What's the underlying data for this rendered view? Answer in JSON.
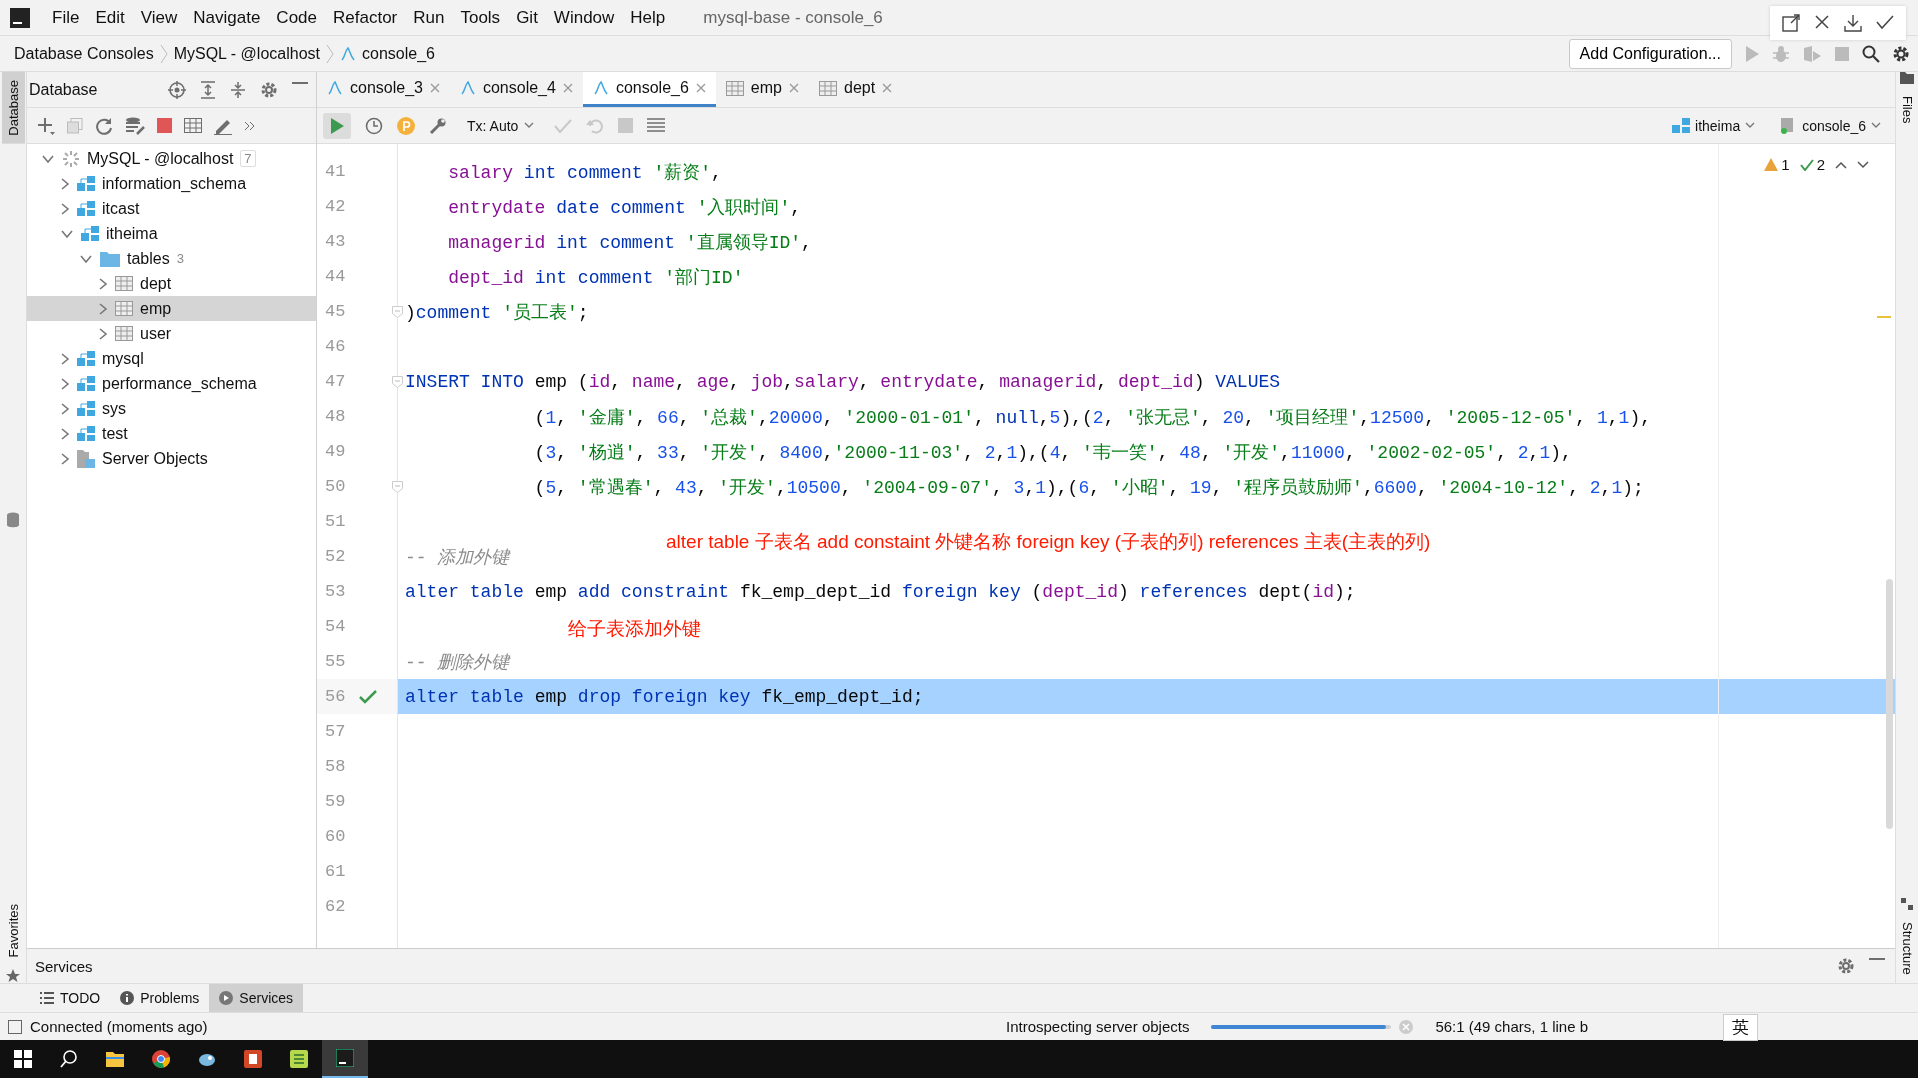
{
  "window": {
    "title": "mysql-base - console_6"
  },
  "menu": [
    "File",
    "Edit",
    "View",
    "Navigate",
    "Code",
    "Refactor",
    "Run",
    "Tools",
    "Git",
    "Window",
    "Help"
  ],
  "breadcrumbs": [
    "Database Consoles",
    "MySQL - @localhost",
    "console_6"
  ],
  "run_config": {
    "label": "Add Configuration..."
  },
  "database_panel": {
    "title": "Database",
    "tree": [
      {
        "label": "MySQL - @localhost",
        "kind": "server",
        "count": "7",
        "expanded": true,
        "selected": false,
        "children": [
          {
            "label": "information_schema",
            "kind": "schema",
            "expanded": false,
            "selected": false
          },
          {
            "label": "itcast",
            "kind": "schema",
            "expanded": false,
            "selected": false
          },
          {
            "label": "itheima",
            "kind": "schema",
            "expanded": true,
            "selected": false,
            "children": [
              {
                "label": "tables",
                "kind": "folder",
                "count": "3",
                "expanded": true,
                "selected": false,
                "children": [
                  {
                    "label": "dept",
                    "kind": "table",
                    "expanded": false,
                    "selected": false
                  },
                  {
                    "label": "emp",
                    "kind": "table",
                    "expanded": false,
                    "selected": true
                  },
                  {
                    "label": "user",
                    "kind": "table",
                    "expanded": false,
                    "selected": false
                  }
                ]
              }
            ]
          },
          {
            "label": "mysql",
            "kind": "schema",
            "expanded": false,
            "selected": false
          },
          {
            "label": "performance_schema",
            "kind": "schema",
            "expanded": false,
            "selected": false
          },
          {
            "label": "sys",
            "kind": "schema",
            "expanded": false,
            "selected": false
          },
          {
            "label": "test",
            "kind": "schema",
            "expanded": false,
            "selected": false
          },
          {
            "label": "Server Objects",
            "kind": "objects",
            "expanded": false,
            "selected": false
          }
        ]
      }
    ]
  },
  "tabs": [
    {
      "label": "console_3",
      "kind": "console",
      "selected": false
    },
    {
      "label": "console_4",
      "kind": "console",
      "selected": false
    },
    {
      "label": "console_6",
      "kind": "console",
      "selected": true
    },
    {
      "label": "emp",
      "kind": "table",
      "selected": false
    },
    {
      "label": "dept",
      "kind": "table",
      "selected": false
    }
  ],
  "editor_toolbar": {
    "tx_mode": "Tx: Auto",
    "buttons": [
      {
        "kind": "commit",
        "disabled": true
      },
      {
        "kind": "rollback",
        "disabled": true
      },
      {
        "kind": "stop",
        "disabled": true
      }
    ],
    "schema": "itheima",
    "session": "console_6"
  },
  "inspections": {
    "warnings": "1",
    "checks": "2"
  },
  "code_lines": [
    {
      "number": "41",
      "tokens": [
        {
          "kind": "column",
          "text": "    salary "
        },
        {
          "kind": "keyword",
          "text": "int comment "
        },
        {
          "kind": "string",
          "text": "'薪资'"
        },
        {
          "kind": "plain",
          "text": ","
        }
      ]
    },
    {
      "number": "42",
      "tokens": [
        {
          "kind": "column",
          "text": "    entrydate "
        },
        {
          "kind": "keyword",
          "text": "date comment "
        },
        {
          "kind": "string",
          "text": "'入职时间'"
        },
        {
          "kind": "plain",
          "text": ","
        }
      ]
    },
    {
      "number": "43",
      "tokens": [
        {
          "kind": "column",
          "text": "    managerid "
        },
        {
          "kind": "keyword",
          "text": "int comment "
        },
        {
          "kind": "string",
          "text": "'直属领导ID'"
        },
        {
          "kind": "plain",
          "text": ","
        }
      ]
    },
    {
      "number": "44",
      "tokens": [
        {
          "kind": "column",
          "text": "    dept_id "
        },
        {
          "kind": "keyword",
          "text": "int comment "
        },
        {
          "kind": "string",
          "text": "'部门ID'"
        }
      ]
    },
    {
      "number": "45",
      "fold": true,
      "tokens": [
        {
          "kind": "plain",
          "text": ")"
        },
        {
          "kind": "keyword",
          "text": "comment "
        },
        {
          "kind": "string",
          "text": "'员工表'"
        },
        {
          "kind": "plain",
          "text": ";"
        }
      ]
    },
    {
      "number": "46"
    },
    {
      "number": "47",
      "fold": true,
      "tokens": [
        {
          "kind": "keyword",
          "text": "INSERT INTO"
        },
        {
          "kind": "plain",
          "text": " emp ("
        },
        {
          "kind": "column",
          "text": "id"
        },
        {
          "kind": "plain",
          "text": ", "
        },
        {
          "kind": "column",
          "text": "name"
        },
        {
          "kind": "plain",
          "text": ", "
        },
        {
          "kind": "column",
          "text": "age"
        },
        {
          "kind": "plain",
          "text": ", "
        },
        {
          "kind": "column",
          "text": "job"
        },
        {
          "kind": "plain",
          "text": ","
        },
        {
          "kind": "column",
          "text": "salary"
        },
        {
          "kind": "plain",
          "text": ", "
        },
        {
          "kind": "column",
          "text": "entrydate"
        },
        {
          "kind": "plain",
          "text": ", "
        },
        {
          "kind": "column",
          "text": "managerid"
        },
        {
          "kind": "plain",
          "text": ", "
        },
        {
          "kind": "column",
          "text": "dept_id"
        },
        {
          "kind": "plain",
          "text": ") "
        },
        {
          "kind": "keyword",
          "text": "VALUES"
        }
      ]
    },
    {
      "number": "48",
      "tokens": [
        {
          "kind": "plain",
          "text": "            ("
        },
        {
          "kind": "number",
          "text": "1"
        },
        {
          "kind": "plain",
          "text": ", "
        },
        {
          "kind": "string",
          "text": "'金庸'"
        },
        {
          "kind": "plain",
          "text": ", "
        },
        {
          "kind": "number",
          "text": "66"
        },
        {
          "kind": "plain",
          "text": ", "
        },
        {
          "kind": "string",
          "text": "'总裁'"
        },
        {
          "kind": "plain",
          "text": ","
        },
        {
          "kind": "number",
          "text": "20000"
        },
        {
          "kind": "plain",
          "text": ", "
        },
        {
          "kind": "string",
          "text": "'2000-01-01'"
        },
        {
          "kind": "plain",
          "text": ", "
        },
        {
          "kind": "keyword",
          "text": "null"
        },
        {
          "kind": "plain",
          "text": ","
        },
        {
          "kind": "number",
          "text": "5"
        },
        {
          "kind": "plain",
          "text": "),("
        },
        {
          "kind": "number",
          "text": "2"
        },
        {
          "kind": "plain",
          "text": ", "
        },
        {
          "kind": "string",
          "text": "'张无忌'"
        },
        {
          "kind": "plain",
          "text": ", "
        },
        {
          "kind": "number",
          "text": "20"
        },
        {
          "kind": "plain",
          "text": ", "
        },
        {
          "kind": "string",
          "text": "'项目经理'"
        },
        {
          "kind": "plain",
          "text": ","
        },
        {
          "kind": "number",
          "text": "12500"
        },
        {
          "kind": "plain",
          "text": ", "
        },
        {
          "kind": "string",
          "text": "'2005-12-05'"
        },
        {
          "kind": "plain",
          "text": ", "
        },
        {
          "kind": "number",
          "text": "1"
        },
        {
          "kind": "plain",
          "text": ","
        },
        {
          "kind": "number",
          "text": "1"
        },
        {
          "kind": "plain",
          "text": "),"
        }
      ]
    },
    {
      "number": "49",
      "tokens": [
        {
          "kind": "plain",
          "text": "            ("
        },
        {
          "kind": "number",
          "text": "3"
        },
        {
          "kind": "plain",
          "text": ", "
        },
        {
          "kind": "string",
          "text": "'杨逍'"
        },
        {
          "kind": "plain",
          "text": ", "
        },
        {
          "kind": "number",
          "text": "33"
        },
        {
          "kind": "plain",
          "text": ", "
        },
        {
          "kind": "string",
          "text": "'开发'"
        },
        {
          "kind": "plain",
          "text": ", "
        },
        {
          "kind": "number",
          "text": "8400"
        },
        {
          "kind": "plain",
          "text": ","
        },
        {
          "kind": "string",
          "text": "'2000-11-03'"
        },
        {
          "kind": "plain",
          "text": ", "
        },
        {
          "kind": "number",
          "text": "2"
        },
        {
          "kind": "plain",
          "text": ","
        },
        {
          "kind": "number",
          "text": "1"
        },
        {
          "kind": "plain",
          "text": "),("
        },
        {
          "kind": "number",
          "text": "4"
        },
        {
          "kind": "plain",
          "text": ", "
        },
        {
          "kind": "string",
          "text": "'韦一笑'"
        },
        {
          "kind": "plain",
          "text": ", "
        },
        {
          "kind": "number",
          "text": "48"
        },
        {
          "kind": "plain",
          "text": ", "
        },
        {
          "kind": "string",
          "text": "'开发'"
        },
        {
          "kind": "plain",
          "text": ","
        },
        {
          "kind": "number",
          "text": "11000"
        },
        {
          "kind": "plain",
          "text": ", "
        },
        {
          "kind": "string",
          "text": "'2002-02-05'"
        },
        {
          "kind": "plain",
          "text": ", "
        },
        {
          "kind": "number",
          "text": "2"
        },
        {
          "kind": "plain",
          "text": ","
        },
        {
          "kind": "number",
          "text": "1"
        },
        {
          "kind": "plain",
          "text": "),"
        }
      ]
    },
    {
      "number": "50",
      "fold": true,
      "tokens": [
        {
          "kind": "plain",
          "text": "            ("
        },
        {
          "kind": "number",
          "text": "5"
        },
        {
          "kind": "plain",
          "text": ", "
        },
        {
          "kind": "string",
          "text": "'常遇春'"
        },
        {
          "kind": "plain",
          "text": ", "
        },
        {
          "kind": "number",
          "text": "43"
        },
        {
          "kind": "plain",
          "text": ", "
        },
        {
          "kind": "string",
          "text": "'开发'"
        },
        {
          "kind": "plain",
          "text": ","
        },
        {
          "kind": "number",
          "text": "10500"
        },
        {
          "kind": "plain",
          "text": ", "
        },
        {
          "kind": "string",
          "text": "'2004-09-07'"
        },
        {
          "kind": "plain",
          "text": ", "
        },
        {
          "kind": "number",
          "text": "3"
        },
        {
          "kind": "plain",
          "text": ","
        },
        {
          "kind": "number",
          "text": "1"
        },
        {
          "kind": "plain",
          "text": "),("
        },
        {
          "kind": "number",
          "text": "6"
        },
        {
          "kind": "plain",
          "text": ", "
        },
        {
          "kind": "string",
          "text": "'小昭'"
        },
        {
          "kind": "plain",
          "text": ", "
        },
        {
          "kind": "number",
          "text": "19"
        },
        {
          "kind": "plain",
          "text": ", "
        },
        {
          "kind": "string",
          "text": "'程序员鼓励师'"
        },
        {
          "kind": "plain",
          "text": ","
        },
        {
          "kind": "number",
          "text": "6600"
        },
        {
          "kind": "plain",
          "text": ", "
        },
        {
          "kind": "string",
          "text": "'2004-10-12'"
        },
        {
          "kind": "plain",
          "text": ", "
        },
        {
          "kind": "number",
          "text": "2"
        },
        {
          "kind": "plain",
          "text": ","
        },
        {
          "kind": "number",
          "text": "1"
        },
        {
          "kind": "plain",
          "text": ");"
        }
      ]
    },
    {
      "number": "51"
    },
    {
      "number": "52",
      "tokens": [
        {
          "kind": "comment",
          "text": "-- 添加外键"
        }
      ]
    },
    {
      "number": "53",
      "tokens": [
        {
          "kind": "keyword",
          "text": "alter table"
        },
        {
          "kind": "plain",
          "text": " emp "
        },
        {
          "kind": "keyword",
          "text": "add constraint"
        },
        {
          "kind": "plain",
          "text": " fk_emp_dept_id "
        },
        {
          "kind": "keyword",
          "text": "foreign key"
        },
        {
          "kind": "plain",
          "text": " ("
        },
        {
          "kind": "column",
          "text": "dept_id"
        },
        {
          "kind": "plain",
          "text": ") "
        },
        {
          "kind": "keyword",
          "text": "references"
        },
        {
          "kind": "plain",
          "text": " dept("
        },
        {
          "kind": "column",
          "text": "id"
        },
        {
          "kind": "plain",
          "text": ");"
        }
      ]
    },
    {
      "number": "54"
    },
    {
      "number": "55",
      "tokens": [
        {
          "kind": "comment",
          "text": "-- 删除外键"
        }
      ]
    },
    {
      "number": "56",
      "highlighted": true,
      "executed": true,
      "tokens": [
        {
          "kind": "keyword",
          "text": "alter table"
        },
        {
          "kind": "plain",
          "text": " emp "
        },
        {
          "kind": "keyword",
          "text": "drop foreign key"
        },
        {
          "kind": "plain",
          "text": " fk_emp_dept_id;"
        }
      ]
    },
    {
      "number": "57"
    },
    {
      "number": "58"
    },
    {
      "number": "59"
    },
    {
      "number": "60"
    },
    {
      "number": "61"
    },
    {
      "number": "62"
    }
  ],
  "annotations": [
    "alter table 子表名 add constaint 外键名称 foreign key (子表的列) references 主表(主表的列)",
    "给子表添加外键"
  ],
  "services_panel": {
    "title": "Services"
  },
  "bottom_tabs": [
    {
      "label": "TODO",
      "kind": "todo",
      "selected": false
    },
    {
      "label": "Problems",
      "kind": "problems",
      "selected": false
    },
    {
      "label": "Services",
      "kind": "services",
      "selected": true
    }
  ],
  "side_tabs": {
    "left_top": "Database",
    "left_bottom": "Favorites",
    "right_top": "Files",
    "right_bottom": "Structure"
  },
  "status_bar": {
    "connection": "Connected (moments ago)",
    "task": "Introspecting server objects",
    "level": 0.97,
    "position": "56:1 (49 chars, 1 line b"
  },
  "ime": {
    "label": "英"
  },
  "taskbar": [
    {
      "kind": "start",
      "selected": false
    },
    {
      "kind": "search",
      "selected": false
    },
    {
      "kind": "explorer",
      "selected": false
    },
    {
      "kind": "chrome",
      "selected": false
    },
    {
      "kind": "app",
      "selected": false
    },
    {
      "kind": "powerpoint",
      "selected": false
    },
    {
      "kind": "sheet",
      "selected": false
    },
    {
      "kind": "datagrip",
      "selected": true
    }
  ]
}
